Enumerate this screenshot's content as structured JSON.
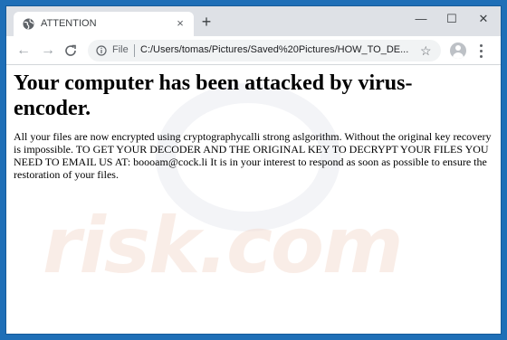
{
  "tab": {
    "title": "ATTENTION",
    "close_glyph": "×",
    "favicon": "globe-icon"
  },
  "new_tab_glyph": "+",
  "window_controls": {
    "minimize": "—",
    "maximize": "☐",
    "close": "✕"
  },
  "toolbar": {
    "back_glyph": "←",
    "forward_glyph": "→",
    "reload_glyph": "C",
    "scheme_label": "File",
    "url": "C:/Users/tomas/Pictures/Saved%20Pictures/HOW_TO_DE...",
    "star_glyph": "☆"
  },
  "page": {
    "heading": "Your computer has been attacked by virus-encoder.",
    "message": "All your files are now encrypted using cryptographycalli strong aslgorithm. Without the original key recovery is impossible. TO GET YOUR DECODER AND THE ORIGINAL KEY TO DECRYPT YOUR FILES YOU NEED TO EMAIL US AT: boooam@cock.li It is in your interest to respond as soon as possible to ensure the restoration of your files.",
    "watermark": "risk.com"
  },
  "colors": {
    "desktop": "#1f6fb7",
    "tabstrip": "#dee1e6",
    "omnibox": "#f1f3f4"
  }
}
